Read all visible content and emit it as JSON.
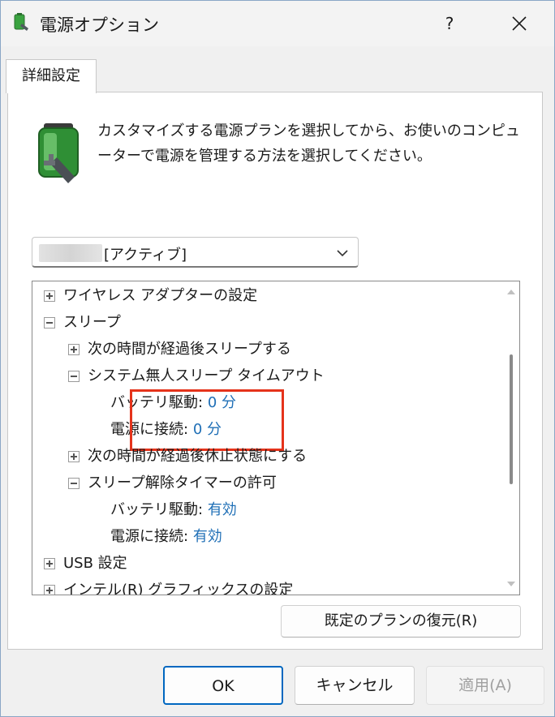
{
  "window": {
    "title": "電源オプション",
    "help": "?"
  },
  "tab": {
    "label": "詳細設定"
  },
  "description": {
    "line1": "カスタマイズする電源プランを選択してから、お使いのコンピュ",
    "line2": "ーターで電源を管理する方法を選択してください。"
  },
  "plan_select": {
    "selected": "[アクティブ]"
  },
  "tree": {
    "items": [
      {
        "label": "ワイヤレス アダプターの設定",
        "expander": "plus"
      },
      {
        "label": "スリープ",
        "expander": "minus"
      },
      {
        "label": "次の時間が経過後スリープする",
        "expander": "plus"
      },
      {
        "label": "システム無人スリープ タイムアウト",
        "expander": "minus"
      },
      {
        "label": "バッテリ駆動:",
        "value": "0 分"
      },
      {
        "label": "電源に接続:",
        "value": "0 分"
      },
      {
        "label": "次の時間が経過後休止状態にする",
        "expander": "plus"
      },
      {
        "label": "スリープ解除タイマーの許可",
        "expander": "minus"
      },
      {
        "label": "バッテリ駆動:",
        "value": "有効"
      },
      {
        "label": "電源に接続:",
        "value": "有効"
      },
      {
        "label": "USB 設定",
        "expander": "plus"
      },
      {
        "label": "インテル(R) グラフィックスの設定",
        "expander": "plus"
      }
    ]
  },
  "buttons": {
    "restore": "既定のプランの復元(R)",
    "ok": "OK",
    "cancel": "キャンセル",
    "apply": "適用(A)"
  },
  "colors": {
    "value_link": "#1f6fb6",
    "highlight_box": "#e5331b",
    "default_button_border": "#0067c0"
  }
}
